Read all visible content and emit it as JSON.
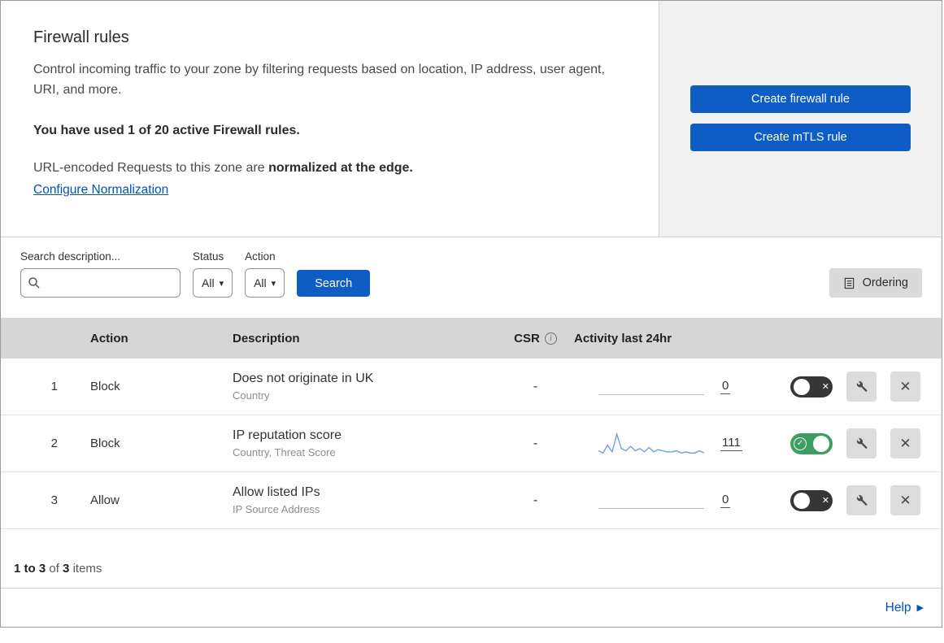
{
  "header": {
    "title": "Firewall rules",
    "description": "Control incoming traffic to your zone by filtering requests based on location, IP address, user agent, URI, and more.",
    "usage_text": "You have used 1 of 20 active Firewall rules.",
    "normalization_prefix": "URL-encoded Requests to this zone are",
    "normalization_bold": "normalized at the edge.",
    "configure_link": "Configure Normalization"
  },
  "actions_panel": {
    "create_firewall_rule": "Create firewall rule",
    "create_mtls_rule": "Create mTLS rule"
  },
  "filters": {
    "search_label": "Search description...",
    "status_label": "Status",
    "status_value": "All",
    "action_label": "Action",
    "action_value": "All",
    "search_button": "Search",
    "ordering_button": "Ordering"
  },
  "table": {
    "columns": {
      "action": "Action",
      "description": "Description",
      "csr": "CSR",
      "activity": "Activity last 24hr"
    },
    "rows": [
      {
        "index": "1",
        "action": "Block",
        "description": "Does not originate in UK",
        "criteria": "Country",
        "csr": "-",
        "activity_count": "0",
        "enabled": "off"
      },
      {
        "index": "2",
        "action": "Block",
        "description": "IP reputation score",
        "criteria": "Country, Threat Score",
        "csr": "-",
        "activity_count": "111",
        "enabled": "on"
      },
      {
        "index": "3",
        "action": "Allow",
        "description": "Allow listed IPs",
        "criteria": "IP Source Address",
        "csr": "-",
        "activity_count": "0",
        "enabled": "off"
      }
    ]
  },
  "pagination": {
    "range": "1 to 3",
    "of": "of",
    "total": "3",
    "items": "items"
  },
  "help": {
    "label": "Help"
  },
  "icons": {
    "caret": "▾",
    "check": "✓",
    "cross": "✕",
    "cross_large": "✕",
    "help_arrow": "▶",
    "info": "i"
  },
  "chart_data": {
    "type": "line",
    "title": "Activity last 24hr",
    "x": "last 24 hours, hourly buckets",
    "legend": false,
    "axes": false,
    "series": [
      {
        "name": "Does not originate in UK",
        "total": 0,
        "values": [
          0,
          0,
          0,
          0,
          0,
          0,
          0,
          0,
          0,
          0,
          0,
          0,
          0,
          0,
          0,
          0,
          0,
          0,
          0,
          0,
          0,
          0,
          0,
          0
        ]
      },
      {
        "name": "IP reputation score",
        "total": 111,
        "values": [
          4,
          2,
          9,
          3,
          19,
          6,
          4,
          8,
          4,
          6,
          3,
          7,
          3,
          5,
          4,
          3,
          3,
          4,
          2,
          3,
          2,
          2,
          4,
          2
        ]
      },
      {
        "name": "Allow listed IPs",
        "total": 0,
        "values": [
          0,
          0,
          0,
          0,
          0,
          0,
          0,
          0,
          0,
          0,
          0,
          0,
          0,
          0,
          0,
          0,
          0,
          0,
          0,
          0,
          0,
          0,
          0,
          0
        ]
      }
    ]
  },
  "colors": {
    "primary": "#0d5dc5",
    "link": "#0051c3",
    "toggle_on": "#3d9e62",
    "toggle_off": "#363636",
    "sparkline": "#6fa1d9"
  }
}
